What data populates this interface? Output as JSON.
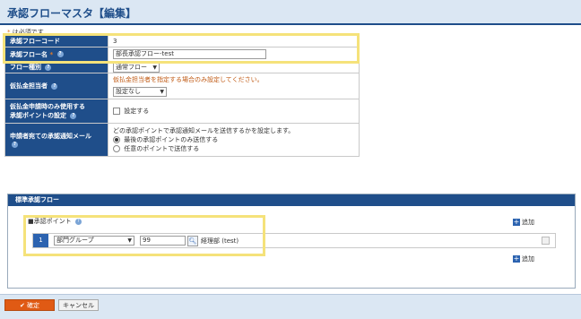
{
  "header": {
    "title": "承認フローマスタ【編集】"
  },
  "required_note": {
    "mark": "*",
    "text": "は必須です"
  },
  "form": {
    "code_label": "承認フローコード",
    "code_value": "3",
    "name_label": "承認フロー名",
    "name_value": "部長承認フロー-test",
    "type_label": "フロー種別",
    "type_value": "通常フロー",
    "payment_label": "仮払金担当者",
    "payment_note": "仮払金担当者を指定する場合のみ設定してください。",
    "payment_select": "設定なし",
    "payment_only_label_1": "仮払金申請時のみ使用する",
    "payment_only_label_2": "承認ポイントの設定",
    "payment_only_checkbox": "設定する",
    "notify_label": "申請者宛ての承認通知メール",
    "notify_desc": "どの承認ポイントで承認通知メールを送信するかを設定します。",
    "notify_opt1": "最後の承認ポイントのみ送信する",
    "notify_opt2": "任意のポイントで送信する"
  },
  "flow_panel": {
    "title": "標準承認フロー",
    "point_heading": "■承認ポイント",
    "add_label": "追加",
    "rows": [
      {
        "num": "1",
        "type": "部門グループ",
        "code": "99",
        "name": "経理部 (test)"
      }
    ]
  },
  "buttons": {
    "confirm": "確定",
    "cancel": "キャンセル"
  }
}
